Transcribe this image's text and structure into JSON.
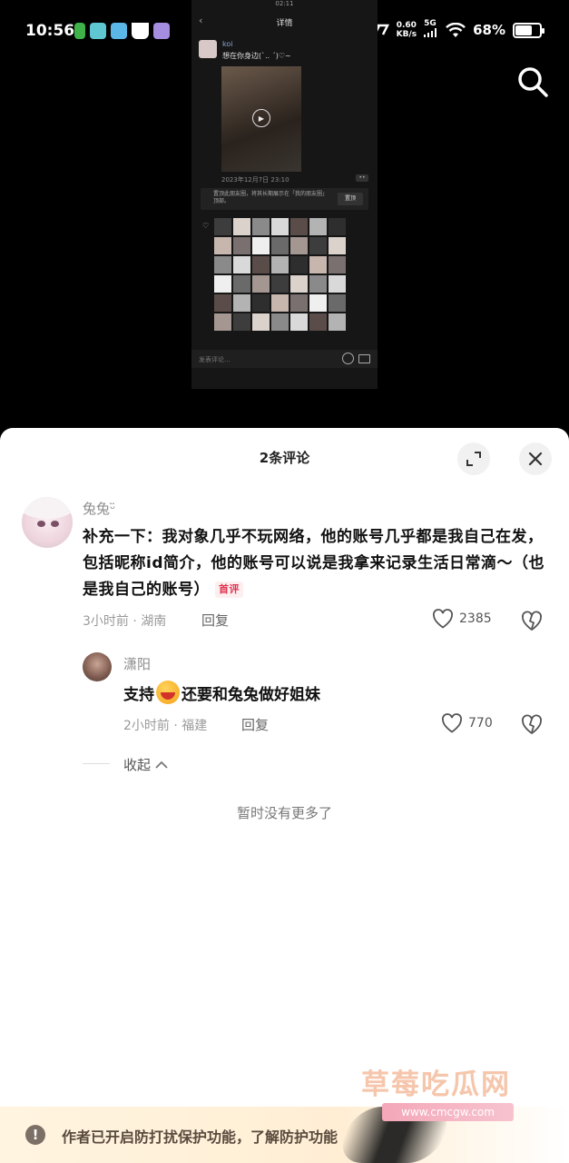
{
  "status_bar": {
    "time": "10:56",
    "network_speed": "0.60",
    "network_unit": "KB/s",
    "network_type": "5G",
    "battery_percent": "68%",
    "battery_level": 0.68
  },
  "embedded_screenshot": {
    "status_time": "02:11",
    "header_title": "详情",
    "user_name": "koi",
    "post_text": "想在你身边(`.. ´)♡~",
    "post_date": "2023年12月7日 23:10",
    "pin_text": "置顶此朋友圈，将其长期展示在「我的朋友圈」顶部。",
    "pin_button": "置顶",
    "comment_placeholder": "发表评论..."
  },
  "sheet": {
    "title": "2条评论"
  },
  "comments": [
    {
      "user": "兔兔ᵕ̈",
      "text": "补充一下：我对象几乎不玩网络，他的账号几乎都是我自己在发，包括昵称id简介，他的账号可以说是我拿来记录生活日常滴～（也是我自己的账号）",
      "badge": "首评",
      "time_location": "3小时前 · 湖南",
      "reply_label": "回复",
      "likes": "2385"
    },
    {
      "user": "潇阳",
      "text_before": "支持",
      "text_after": "还要和兔兔做好姐妹",
      "time_location": "2小时前 · 福建",
      "reply_label": "回复",
      "likes": "770"
    }
  ],
  "collapse_label": "收起",
  "no_more_text": "暂时没有更多了",
  "watermark": {
    "title": "草莓吃瓜网",
    "url": "www.cmcgw.com"
  },
  "banner": {
    "text": "作者已开启防打扰保护功能，了解防护功能"
  },
  "colors": {
    "badge_red": "#e0344f",
    "banner_bg": "#fff4e0"
  }
}
